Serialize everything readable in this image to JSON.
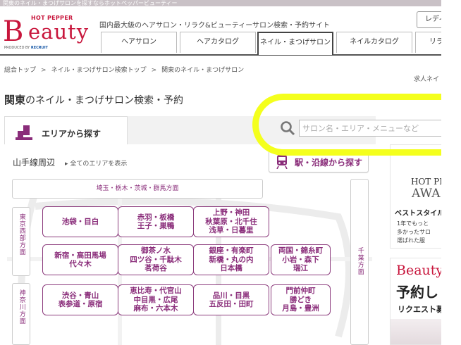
{
  "top_strip": "関東のネイル・まつげサロンを探すならホットペッパービューティー",
  "logo": {
    "hot_pepper": "HOT PEPPER",
    "beauty": "eauty",
    "produced_by": "PRODUCED BY",
    "recruit": "RECRUIT"
  },
  "header": {
    "tagline": "国内最大級のヘアサロン・リラク&ビューティーサロン検索・予約サイト",
    "ladies_button": "レディ"
  },
  "nav": {
    "tabs": [
      {
        "label": "ヘアサロン"
      },
      {
        "label": "ヘアカタログ"
      },
      {
        "label": "ネイル・まつげサロン"
      },
      {
        "label": "ネイルカタログ"
      },
      {
        "label": "リラ"
      }
    ]
  },
  "breadcrumb": {
    "items": [
      "総合トップ",
      "ネイル・まつげサロン検索トップ",
      "関東のネイル・まつげサロン"
    ],
    "separator": ">"
  },
  "jobs_link": "求人ネイ",
  "title": {
    "bold": "関東",
    "rest": "のネイル・まつげサロン検索・予約"
  },
  "search": {
    "placeholder": "サロン名・エリア・メニューなど"
  },
  "area_panel": {
    "tab_label": "エリアから探す",
    "region": "山手線周辺",
    "all_areas": "全てのエリアを表示",
    "station_button": "駅・沿線から探す",
    "direction_top": "埼玉・栃木・茨城・群馬方面",
    "direction_west": "東京西部方面",
    "direction_kanagawa": "神奈川方面",
    "direction_chiba": "千葉方面",
    "areas": [
      {
        "l1": "池袋・目白",
        "l2": "",
        "l3": ""
      },
      {
        "l1": "赤羽・板橋",
        "l2": "王子・巣鴨",
        "l3": ""
      },
      {
        "l1": "上野・神田",
        "l2": "秋葉原・北千住",
        "l3": "浅草・日暮里"
      },
      {
        "l1": "新宿・高田馬場",
        "l2": "代々木",
        "l3": ""
      },
      {
        "l1": "御茶ノ水",
        "l2": "四ツ谷・千駄木",
        "l3": "茗荷谷"
      },
      {
        "l1": "銀座・有楽町",
        "l2": "新橋・丸の内",
        "l3": "日本橋"
      },
      {
        "l1": "両国・錦糸町",
        "l2": "小岩・森下",
        "l3": "瑞江"
      },
      {
        "l1": "渋谷・青山",
        "l2": "表参道・原宿",
        "l3": ""
      },
      {
        "l1": "恵比寿・代官山",
        "l2": "中目黒・広尾",
        "l3": "麻布・六本木"
      },
      {
        "l1": "品川・目黒",
        "l2": "五反田・田町",
        "l3": ""
      },
      {
        "l1": "門前仲町",
        "l2": "勝どき",
        "l3": "月島・豊洲"
      }
    ]
  },
  "ads": {
    "ad1": {
      "t1": "HOT PE",
      "t2": "AWA",
      "t3": "ベストスタイル",
      "t4a": "1年でもっと",
      "t4b": "多かったサロ",
      "t4c": "選ばれた服"
    },
    "ad2": {
      "logo": "Beauty",
      "head": "予約し",
      "sub": "リクエスト募"
    }
  },
  "colors": {
    "brand": "#c8163c",
    "accent": "#8a2d7a",
    "highlight": "#f4ff1d"
  }
}
